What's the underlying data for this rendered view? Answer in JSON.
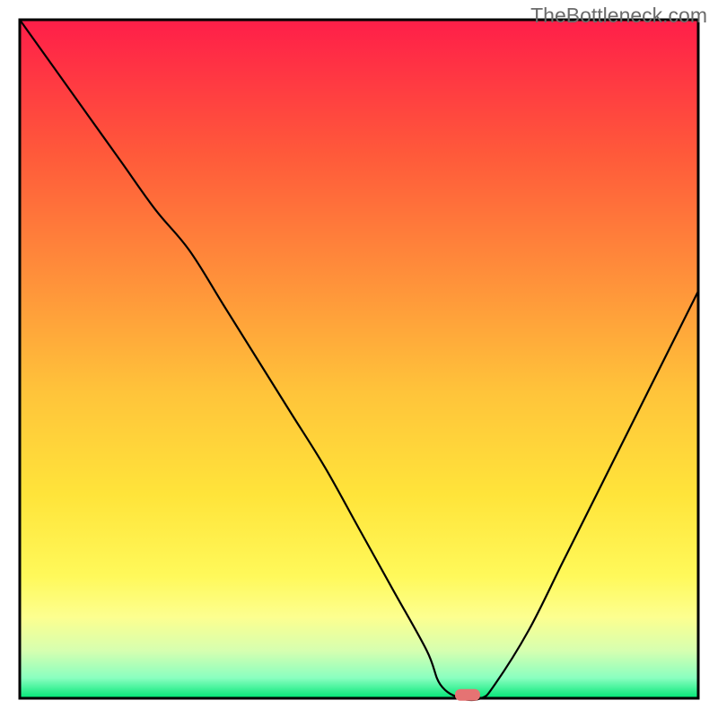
{
  "watermark": "TheBottleneck.com",
  "chart_data": {
    "type": "line",
    "title": "",
    "xlabel": "",
    "ylabel": "",
    "xlim": [
      0,
      100
    ],
    "ylim": [
      0,
      100
    ],
    "x": [
      0,
      5,
      10,
      15,
      20,
      25,
      30,
      35,
      40,
      45,
      50,
      55,
      60,
      62,
      65,
      68,
      70,
      75,
      80,
      85,
      90,
      95,
      100
    ],
    "y": [
      100,
      93,
      86,
      79,
      72,
      66,
      58,
      50,
      42,
      34,
      25,
      16,
      7,
      2,
      0,
      0,
      2,
      10,
      20,
      30,
      40,
      50,
      60
    ],
    "grid": false,
    "legend_position": "none",
    "background_gradient": {
      "stops": [
        {
          "offset": 0.0,
          "color": "#ff1e49"
        },
        {
          "offset": 0.2,
          "color": "#ff5a3a"
        },
        {
          "offset": 0.4,
          "color": "#ff963a"
        },
        {
          "offset": 0.55,
          "color": "#ffc43a"
        },
        {
          "offset": 0.7,
          "color": "#ffe43a"
        },
        {
          "offset": 0.82,
          "color": "#fff95a"
        },
        {
          "offset": 0.88,
          "color": "#fdff8f"
        },
        {
          "offset": 0.93,
          "color": "#d6ffb0"
        },
        {
          "offset": 0.97,
          "color": "#8affc0"
        },
        {
          "offset": 1.0,
          "color": "#00e676"
        }
      ]
    },
    "marker": {
      "x": 66,
      "y": 0.5,
      "color": "#e57373",
      "shape": "pill"
    }
  }
}
